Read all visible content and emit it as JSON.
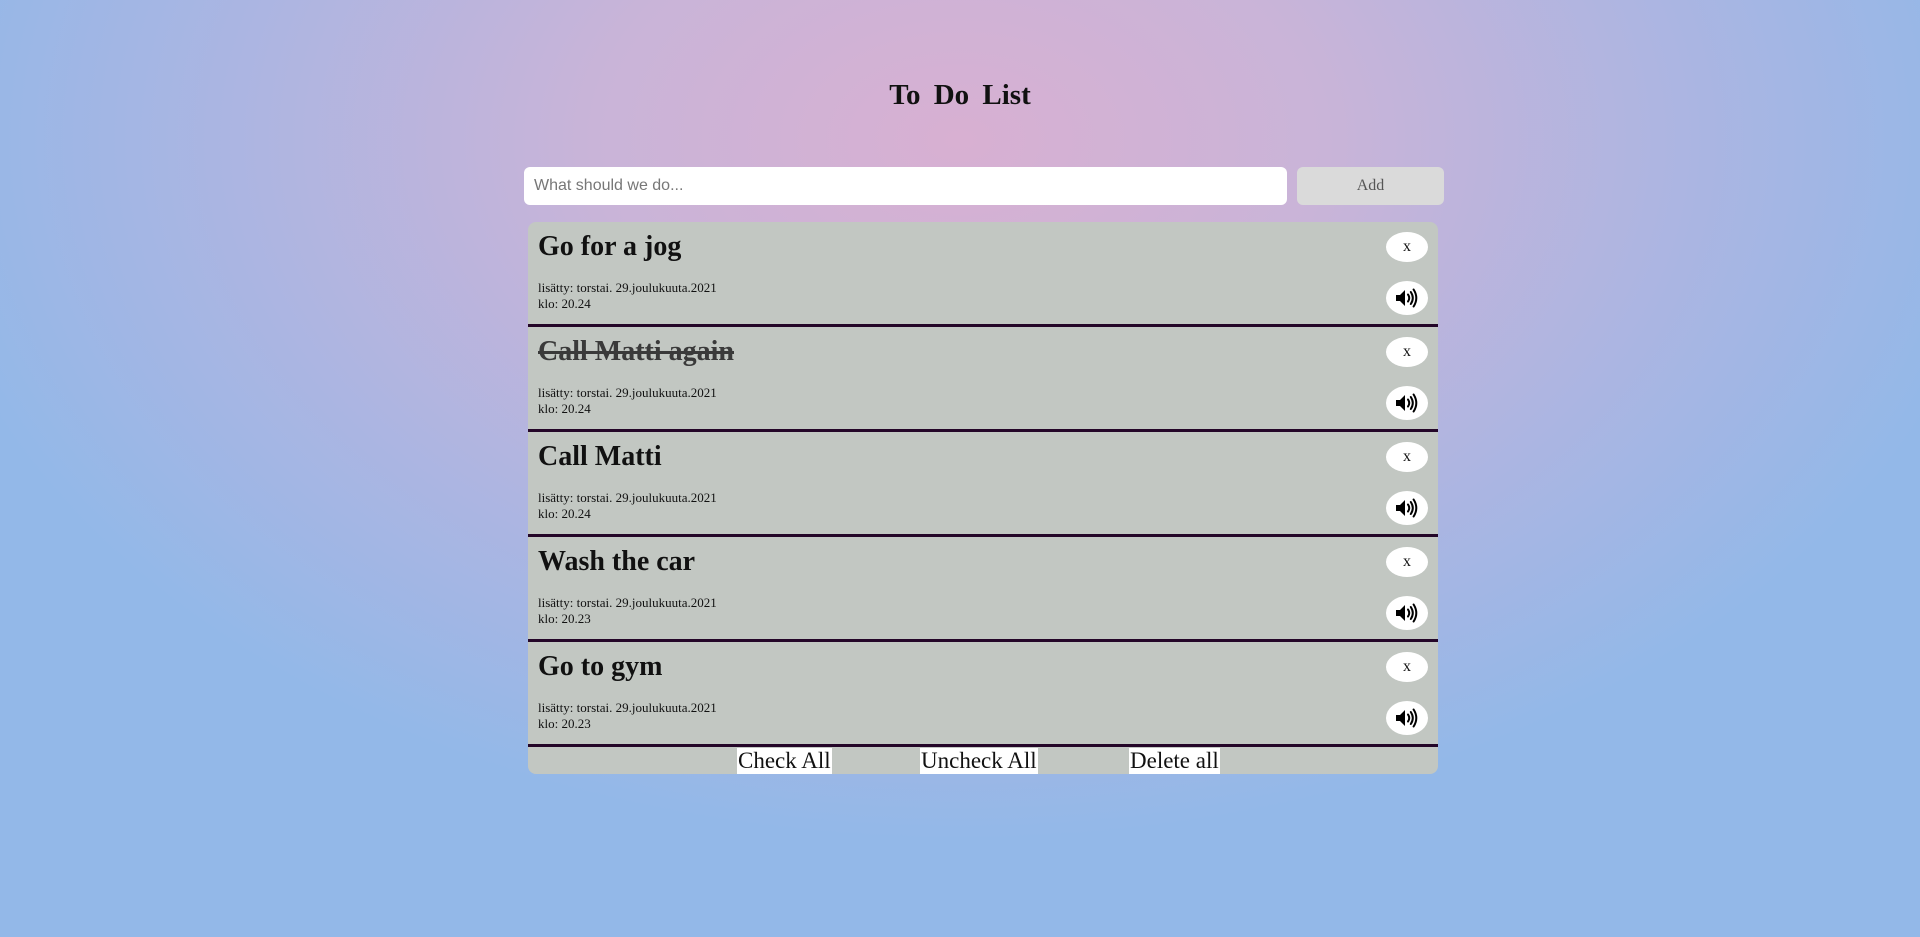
{
  "header": {
    "title": "To Do List"
  },
  "form": {
    "placeholder": "What should we do...",
    "value": "",
    "add_label": "Add"
  },
  "items": [
    {
      "text": "Go for a jog",
      "added": "lisätty: torstai. 29.joulukuuta.2021",
      "time": "klo: 20.24",
      "done": false,
      "delete_label": "x",
      "speak_icon": "speaker-icon"
    },
    {
      "text": "Call Matti again",
      "added": "lisätty: torstai. 29.joulukuuta.2021",
      "time": "klo: 20.24",
      "done": true,
      "delete_label": "x",
      "speak_icon": "speaker-icon"
    },
    {
      "text": "Call Matti",
      "added": "lisätty: torstai. 29.joulukuuta.2021",
      "time": "klo: 20.24",
      "done": false,
      "delete_label": "x",
      "speak_icon": "speaker-icon"
    },
    {
      "text": "Wash the car",
      "added": "lisätty: torstai. 29.joulukuuta.2021",
      "time": "klo: 20.23",
      "done": false,
      "delete_label": "x",
      "speak_icon": "speaker-icon"
    },
    {
      "text": "Go to gym",
      "added": "lisätty: torstai. 29.joulukuuta.2021",
      "time": "klo: 20.23",
      "done": false,
      "delete_label": "x",
      "speak_icon": "speaker-icon"
    }
  ],
  "footer": {
    "check_all": "Check All",
    "uncheck_all": "Uncheck All",
    "delete_all": "Delete all"
  },
  "colors": {
    "list_bg": "#c2c7c2",
    "divider": "#240628",
    "add_button_bg": "#dadada"
  }
}
